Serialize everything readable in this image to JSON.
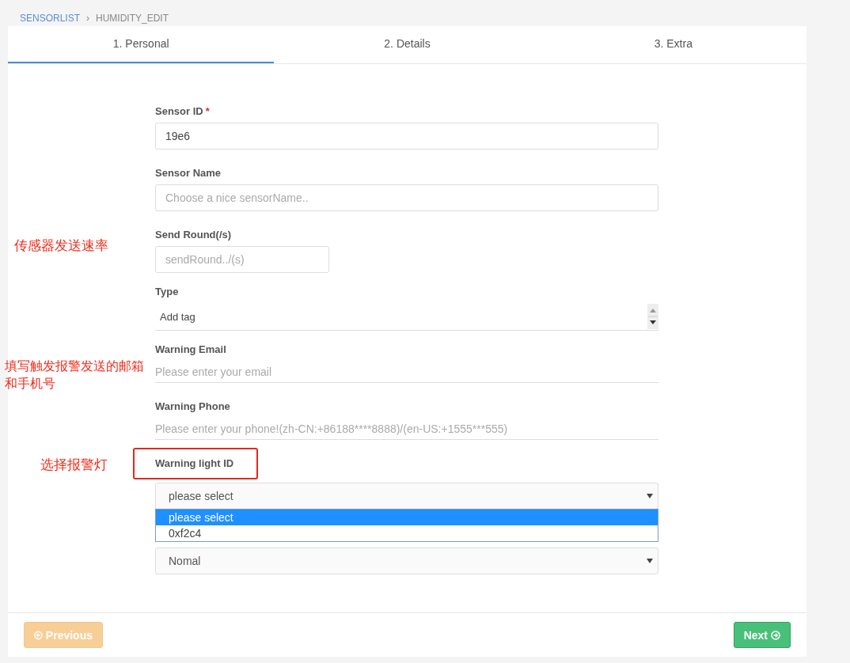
{
  "breadcrumb": [
    {
      "label": "SENSORLIST",
      "kind": "link"
    },
    {
      "label": "›",
      "kind": "separator"
    },
    {
      "label": "HUMIDITY_EDIT",
      "kind": "current"
    }
  ],
  "tabs": [
    {
      "label": "1. Personal",
      "selected": true
    },
    {
      "label": "2. Details",
      "selected": false
    },
    {
      "label": "3. Extra",
      "selected": false
    }
  ],
  "fields": [
    {
      "kind": "text",
      "label": "Sensor ID",
      "required_mark": "*",
      "value": "19e6"
    },
    {
      "kind": "text",
      "label": "Sensor Name",
      "placeholder": "Choose a nice sensorName.."
    },
    {
      "kind": "short",
      "label": "Send Round(/s)",
      "placeholder": "sendRound../(s)",
      "annotation": "传感器发送速率"
    },
    {
      "kind": "tags",
      "label": "Type",
      "placeholder": "Add tag"
    },
    {
      "kind": "underline",
      "label": "Warning Email",
      "placeholder": "Please enter your email",
      "annotation": "填写触发报警发送的邮箱和手机号"
    },
    {
      "kind": "underline",
      "label": "Warning Phone",
      "placeholder": "Please enter your phone!(zh-CN:+86188****8888)/(en-US:+1555***555)"
    },
    {
      "kind": "select",
      "label": "Warning light ID",
      "highlighted": true,
      "annotation": "选择报警灯",
      "value": "please select",
      "options": [
        {
          "label": "please select",
          "selected": true
        },
        {
          "label": "0xf2c4",
          "selected": false
        }
      ]
    },
    {
      "kind": "select",
      "value": "Nomal"
    }
  ],
  "buttons": [
    {
      "label": "Previous",
      "kind": "previous",
      "disabled": true
    },
    {
      "label": "Next",
      "kind": "next",
      "disabled": false
    }
  ]
}
